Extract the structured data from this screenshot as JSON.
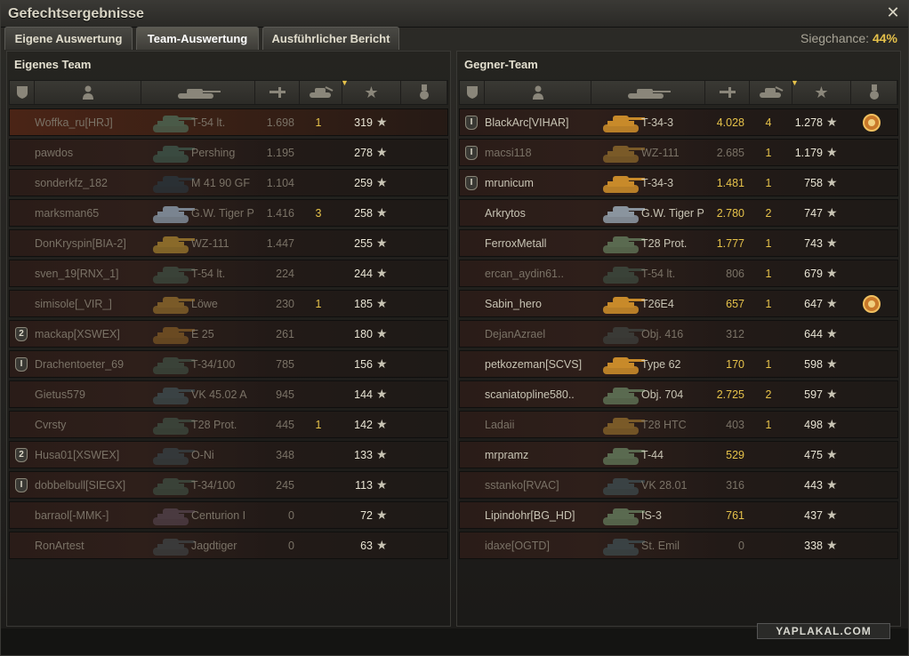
{
  "window": {
    "title": "Gefechtsergebnisse"
  },
  "tabs": [
    {
      "label": "Eigene Auswertung",
      "active": false
    },
    {
      "label": "Team-Auswertung",
      "active": true
    },
    {
      "label": "Ausführlicher Bericht",
      "active": false
    }
  ],
  "win_chance": {
    "label": "Siegchance:",
    "value": "44%"
  },
  "colors": {
    "accent": "#e6c24a",
    "own_row": "#4a2416",
    "dead_text": "#7a7266"
  },
  "own_team": {
    "title": "Eigenes Team",
    "columns": [
      "rank-icon",
      "player-icon",
      "tank-icon",
      "damage-icon",
      "kills-icon",
      "score-icon",
      "medal-icon"
    ],
    "rows": [
      {
        "rank": "",
        "name": "Woffka_ru[HRJ]",
        "tank": "T-54 lt.",
        "xp": "1.698",
        "kills": "1",
        "score": "319",
        "own": true,
        "dead": true,
        "tank_color": "#4a5a48"
      },
      {
        "rank": "",
        "name": "pawdos",
        "tank": "Pershing",
        "xp": "1.195",
        "kills": "",
        "score": "278",
        "dead": true,
        "tank_color": "#3a4a40"
      },
      {
        "rank": "",
        "name": "sonderkfz_182",
        "tank": "M 41 90 GF",
        "xp": "1.104",
        "kills": "",
        "score": "259",
        "dead": true,
        "tank_color": "#2a3034"
      },
      {
        "rank": "",
        "name": "marksman65",
        "tank": "G.W. Tiger P",
        "xp": "1.416",
        "kills": "3",
        "score": "258",
        "dead": true,
        "tank_color": "#7a8490"
      },
      {
        "rank": "",
        "name": "DonKryspin[BIA-2]",
        "tank": "WZ-111",
        "xp": "1.447",
        "kills": "",
        "score": "255",
        "dead": true,
        "tank_color": "#8a6a2a"
      },
      {
        "rank": "",
        "name": "sven_19[RNX_1]",
        "tank": "T-54 lt.",
        "xp": "224",
        "kills": "",
        "score": "244",
        "dead": true,
        "tank_color": "#3a4238"
      },
      {
        "rank": "",
        "name": "simisole[_VIR_]",
        "tank": "Löwe",
        "xp": "230",
        "kills": "1",
        "score": "185",
        "dead": true,
        "tank_color": "#7a5a28"
      },
      {
        "rank": "2",
        "name": "mackap[XSWEX]",
        "tank": "E 25",
        "xp": "261",
        "kills": "",
        "score": "180",
        "dead": true,
        "tank_color": "#6a4a22"
      },
      {
        "rank": "1",
        "name": "Drachentoeter_69",
        "tank": "T-34/100",
        "xp": "785",
        "kills": "",
        "score": "156",
        "dead": true,
        "tank_color": "#3a4238"
      },
      {
        "rank": "",
        "name": "Gietus579",
        "tank": "VK 45.02 A",
        "xp": "945",
        "kills": "",
        "score": "144",
        "dead": true,
        "tank_color": "#3a4244"
      },
      {
        "rank": "",
        "name": "Cvrsty",
        "tank": "T28 Prot.",
        "xp": "445",
        "kills": "1",
        "score": "142",
        "dead": true,
        "tank_color": "#3a4238"
      },
      {
        "rank": "2",
        "name": "Husa01[XSWEX]",
        "tank": "O-Ni",
        "xp": "348",
        "kills": "",
        "score": "133",
        "dead": true,
        "tank_color": "#34383a"
      },
      {
        "rank": "1",
        "name": "dobbelbull[SIEGX]",
        "tank": "T-34/100",
        "xp": "245",
        "kills": "",
        "score": "113",
        "dead": true,
        "tank_color": "#3a4238"
      },
      {
        "rank": "",
        "name": "barraol[-MMK-]",
        "tank": "Centurion I",
        "xp": "0",
        "kills": "",
        "score": "72",
        "dead": true,
        "tank_color": "#4a3a40"
      },
      {
        "rank": "",
        "name": "RonArtest",
        "tank": "Jagdtiger",
        "xp": "0",
        "kills": "",
        "score": "63",
        "dead": true,
        "tank_color": "#3a3a3a"
      }
    ]
  },
  "enemy_team": {
    "title": "Gegner-Team",
    "columns": [
      "rank-icon",
      "player-icon",
      "tank-icon",
      "damage-icon",
      "kills-icon",
      "score-icon",
      "medal-icon"
    ],
    "rows": [
      {
        "rank": "1",
        "name": "BlackArc[VIHAR]",
        "tank": "T-34-3",
        "xp": "4.028",
        "kills": "4",
        "score": "1.278",
        "medal": true,
        "bright": true,
        "tank_color": "#c88a2a"
      },
      {
        "rank": "1",
        "name": "macsi118",
        "tank": "WZ-111",
        "xp": "2.685",
        "kills": "1",
        "score": "1.179",
        "dead": true,
        "tank_color": "#7a5a28"
      },
      {
        "rank": "1",
        "name": "mrunicum",
        "tank": "T-34-3",
        "xp": "1.481",
        "kills": "1",
        "score": "758",
        "bright": true,
        "tank_color": "#c88a2a"
      },
      {
        "rank": "",
        "name": "Arkrytos",
        "tank": "G.W. Tiger P",
        "xp": "2.780",
        "kills": "2",
        "score": "747",
        "bright": true,
        "tank_color": "#8a949e"
      },
      {
        "rank": "",
        "name": "FerroxMetall",
        "tank": "T28 Prot.",
        "xp": "1.777",
        "kills": "1",
        "score": "743",
        "bright": true,
        "tank_color": "#5a6a50"
      },
      {
        "rank": "",
        "name": "ercan_aydin61..",
        "tank": "T-54 lt.",
        "xp": "806",
        "kills": "1",
        "score": "679",
        "dead": true,
        "tank_color": "#3a4238"
      },
      {
        "rank": "",
        "name": "Sabin_hero",
        "tank": "T26E4",
        "xp": "657",
        "kills": "1",
        "score": "647",
        "medal": true,
        "bright": true,
        "tank_color": "#c88a2a"
      },
      {
        "rank": "",
        "name": "DejanAzrael",
        "tank": "Obj. 416",
        "xp": "312",
        "kills": "",
        "score": "644",
        "dead": true,
        "tank_color": "#3a3a36"
      },
      {
        "rank": "",
        "name": "petkozeman[SCVS]",
        "tank": "Type 62",
        "xp": "170",
        "kills": "1",
        "score": "598",
        "bright": true,
        "tank_color": "#c88a2a"
      },
      {
        "rank": "",
        "name": "scaniatopline580..",
        "tank": "Obj. 704",
        "xp": "2.725",
        "kills": "2",
        "score": "597",
        "bright": true,
        "tank_color": "#5a6a50"
      },
      {
        "rank": "",
        "name": "Ladaii",
        "tank": "T28 HTC",
        "xp": "403",
        "kills": "1",
        "score": "498",
        "dead": true,
        "tank_color": "#7a5a28"
      },
      {
        "rank": "",
        "name": "mrpramz",
        "tank": "T-44",
        "xp": "529",
        "kills": "",
        "score": "475",
        "bright": true,
        "tank_color": "#5a6a50"
      },
      {
        "rank": "",
        "name": "sstanko[RVAC]",
        "tank": "VK 28.01",
        "xp": "316",
        "kills": "",
        "score": "443",
        "dead": true,
        "tank_color": "#3a4244"
      },
      {
        "rank": "",
        "name": "Lipindohr[BG_HD]",
        "tank": "IS-3",
        "xp": "761",
        "kills": "",
        "score": "437",
        "bright": true,
        "tank_color": "#5a6a50"
      },
      {
        "rank": "",
        "name": "idaxe[OGTD]",
        "tank": "St. Emil",
        "xp": "0",
        "kills": "",
        "score": "338",
        "dead": true,
        "tank_color": "#3a4244"
      }
    ]
  },
  "watermark": "YAPLAKAL.COM"
}
